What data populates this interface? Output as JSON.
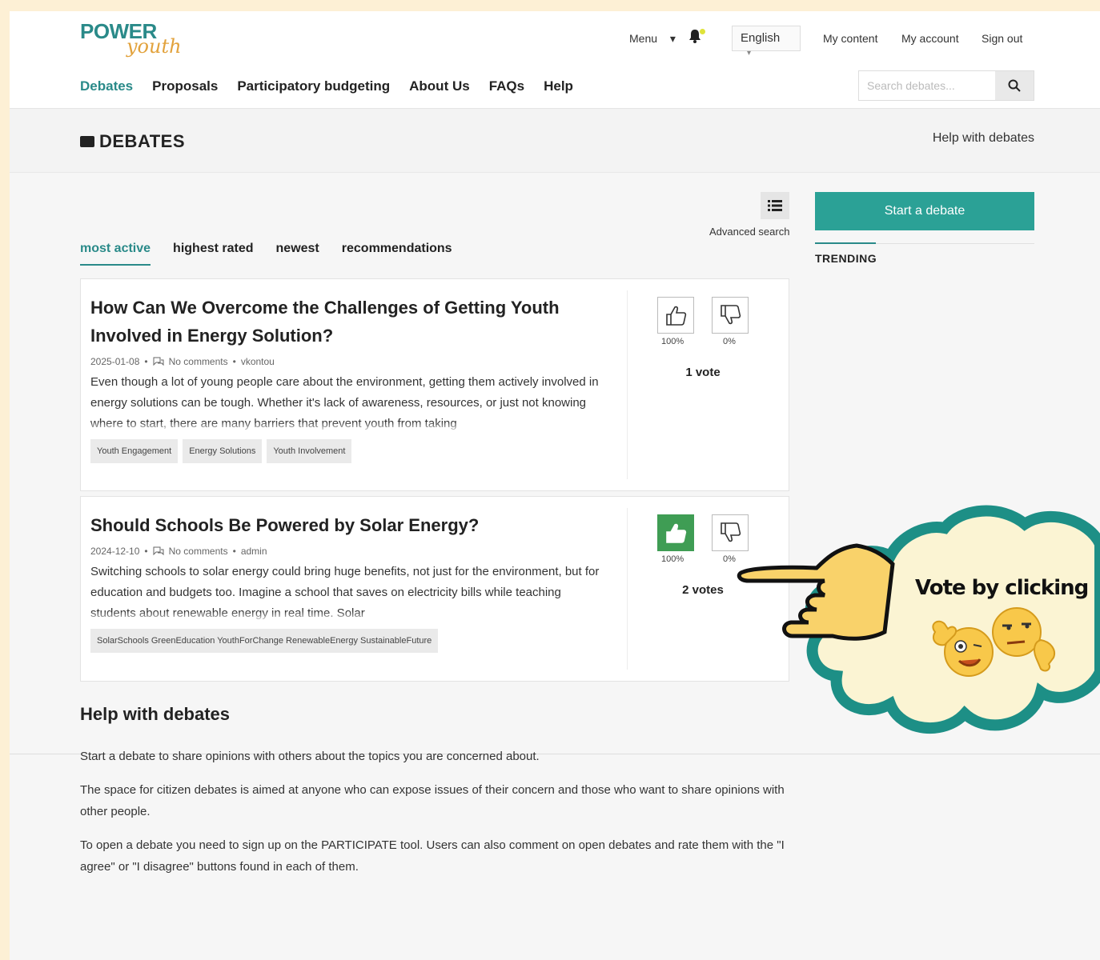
{
  "logo": {
    "power": "POWER",
    "youth": "youth"
  },
  "utility": {
    "menu_label": "Menu",
    "language": "English",
    "my_content": "My content",
    "my_account": "My account",
    "sign_out": "Sign out"
  },
  "nav": {
    "items": [
      {
        "label": "Debates",
        "active": true
      },
      {
        "label": "Proposals"
      },
      {
        "label": "Participatory budgeting"
      },
      {
        "label": "About Us"
      },
      {
        "label": "FAQs"
      },
      {
        "label": "Help"
      }
    ]
  },
  "search": {
    "placeholder": "Search debates..."
  },
  "page": {
    "title": "DEBATES",
    "help_link": "Help with debates",
    "advanced_search": "Advanced search",
    "start_debate": "Start a debate",
    "trending": "TRENDING"
  },
  "tabs": [
    {
      "label": "most active",
      "active": true
    },
    {
      "label": "highest rated"
    },
    {
      "label": "newest"
    },
    {
      "label": "recommendations"
    }
  ],
  "debates": [
    {
      "title": "How Can We Overcome the Challenges of Getting Youth Involved in Energy Solution?",
      "date": "2025-01-08",
      "comments": "No comments",
      "author": "vkontou",
      "description": "Even though a lot of young people care about the environment, getting them actively involved in energy solutions can be tough. Whether it's lack of awareness, resources, or just not knowing where to start, there are many barriers that prevent youth from taking",
      "tags": [
        "Youth Engagement",
        "Energy Solutions",
        "Youth Involvement"
      ],
      "agree_pct": "100%",
      "disagree_pct": "0%",
      "votes": "1 vote",
      "agreed": false
    },
    {
      "title": "Should Schools Be Powered by Solar Energy?",
      "date": "2024-12-10",
      "comments": "No comments",
      "author": "admin",
      "description": "Switching schools to solar energy could bring huge benefits, not just for the environment, but for education and budgets too. Imagine a school that saves on electricity bills while teaching students about renewable energy in real time. Solar",
      "tags": [
        "SolarSchools GreenEducation YouthForChange RenewableEnergy SustainableFuture"
      ],
      "agree_pct": "100%",
      "disagree_pct": "0%",
      "votes": "2 votes",
      "agreed": true
    }
  ],
  "help": {
    "heading": "Help with debates",
    "p1": "Start a debate to share opinions with others about the topics you are concerned about.",
    "p2": "The space for citizen debates is aimed at anyone who can expose issues of their concern and those who want to share opinions with other people.",
    "p3": "To open a debate you need to sign up on the PARTICIPATE tool. Users can also comment on open debates and rate them with the \"I agree\" or \"I disagree\" buttons found in each of them."
  },
  "callout": {
    "text": "Vote by clicking"
  },
  "colors": {
    "teal": "#2a8a89",
    "button_teal": "#2ba196",
    "agree_green": "#3f9d54",
    "background": "#fdf0d5"
  }
}
